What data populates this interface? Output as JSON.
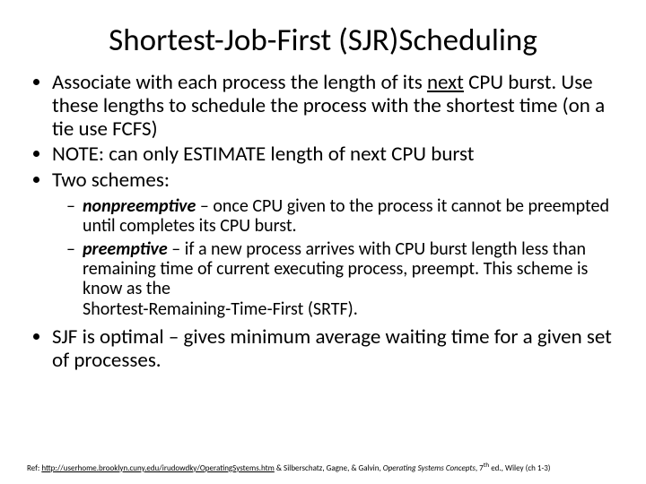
{
  "title": "Shortest-Job-First (SJR)Scheduling",
  "bullets": {
    "b1_pre": "Associate with each process the length of its ",
    "b1_underlined": "next",
    "b1_post": " CPU burst. Use these lengths to schedule the process with the shortest time (on a tie use FCFS)",
    "b2": "NOTE:  can only ESTIMATE length of next CPU burst",
    "b3": "Two schemes:",
    "sub1_term": "nonpreemptive",
    "sub1_rest": " – once CPU given to the process it cannot be preempted until completes its CPU burst.",
    "sub2_term": "preemptive",
    "sub2_rest_a": " – if a new process arrives with CPU burst length less than remaining time of current executing process, preempt.  This scheme is know as the",
    "sub2_rest_b": "Shortest-Remaining-Time-First (SRTF).",
    "b4": "SJF is optimal – gives minimum average waiting time for a given set of processes."
  },
  "footer": {
    "pre": "Ref: ",
    "link": "http://userhome.brooklyn.cuny.edu/irudowdky/OperatingSystems.htm",
    "post_a": "  & Silberschatz, Gagne, & Galvin, ",
    "post_italic": "Operating Systems Concepts",
    "post_b": ", 7",
    "post_sup": "th",
    "post_c": " ed., Wiley (ch 1-3)"
  }
}
